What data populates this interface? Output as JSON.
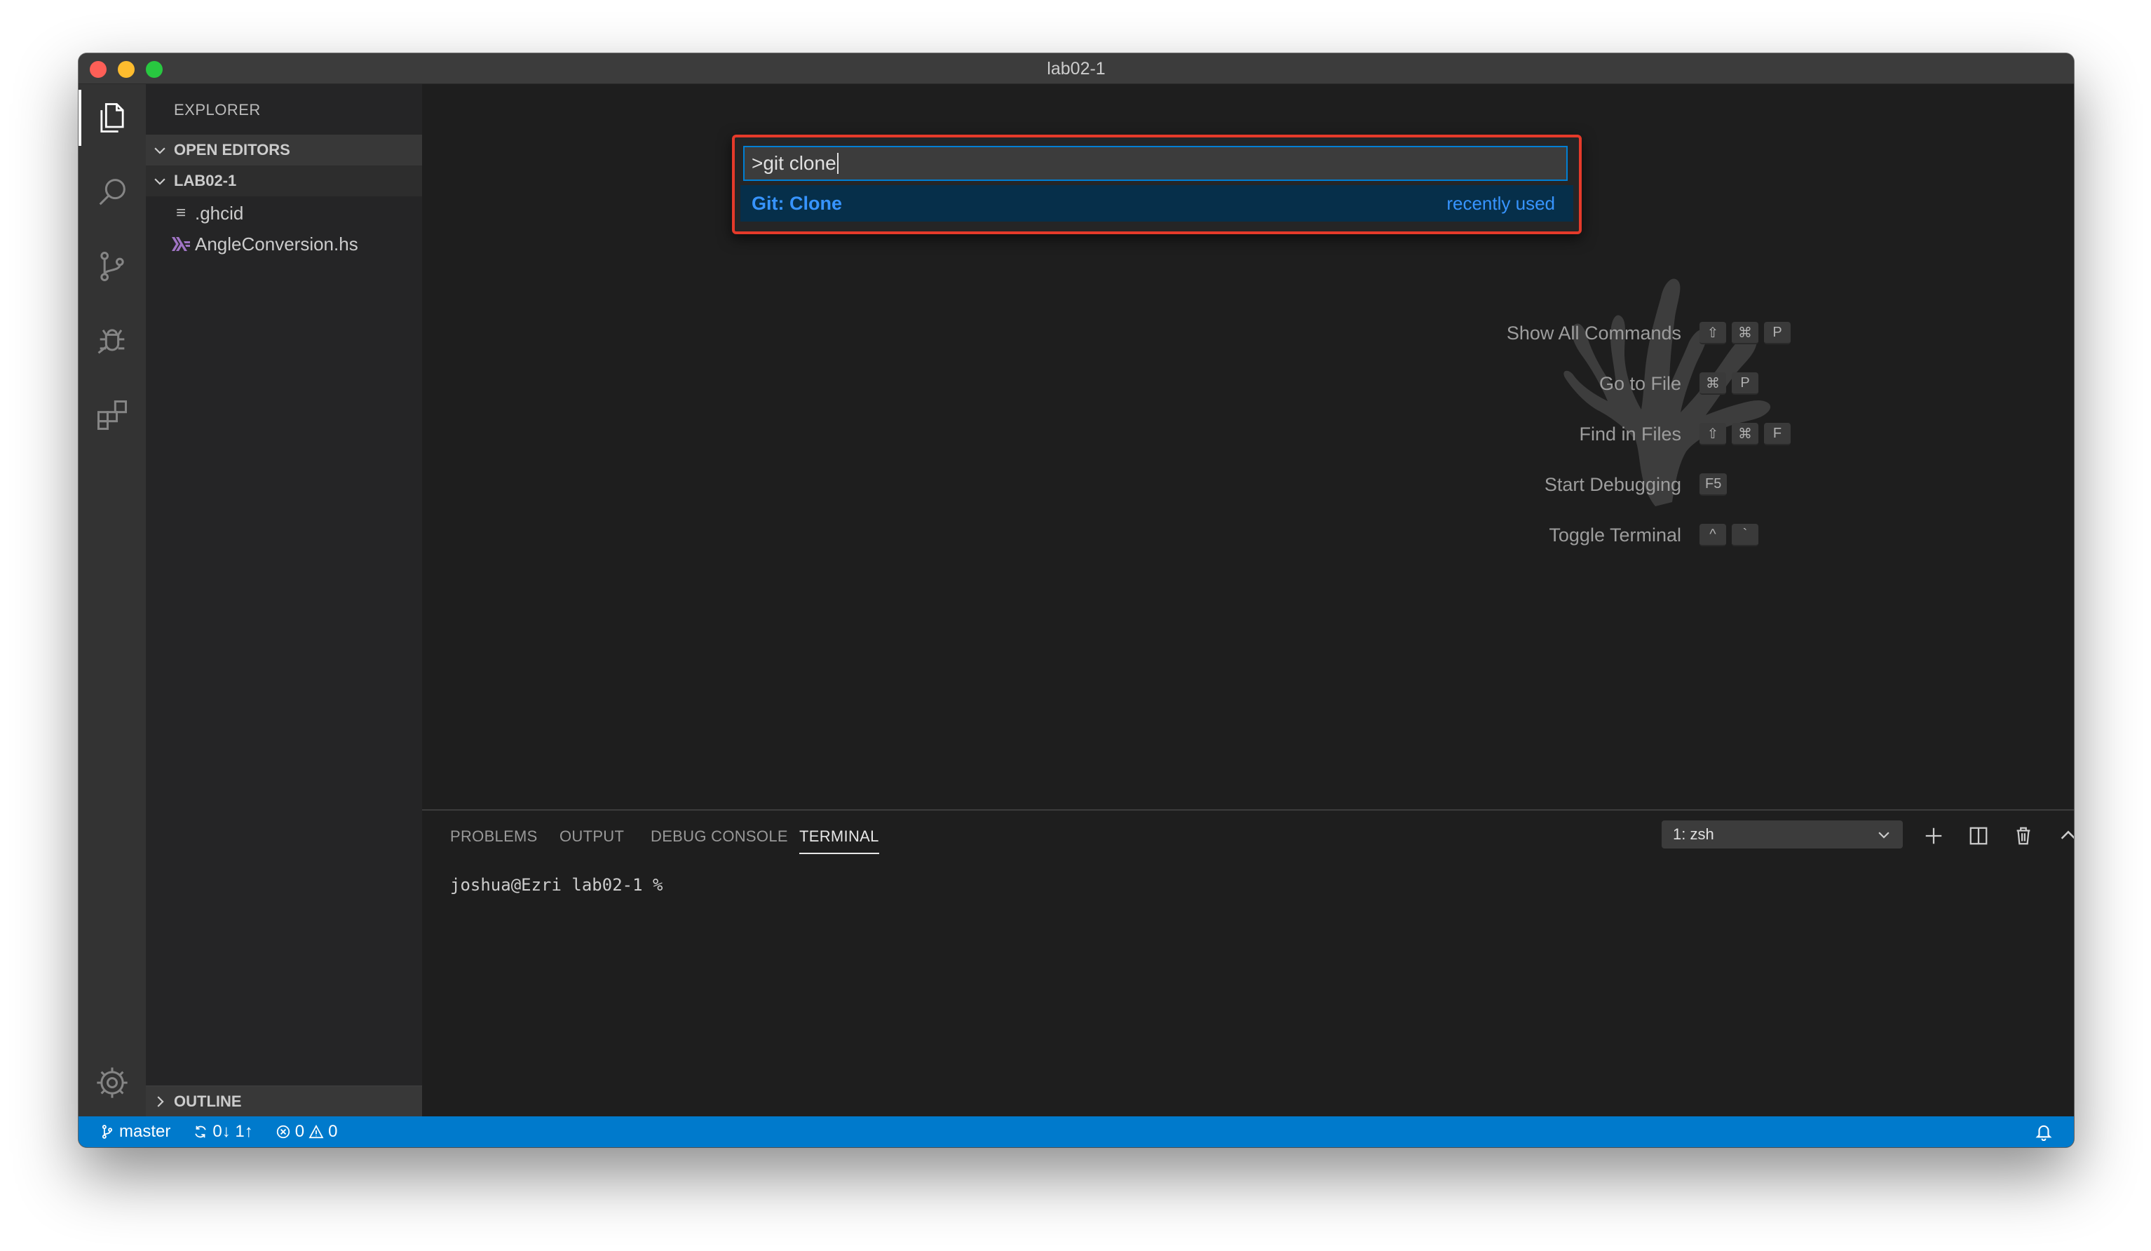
{
  "window": {
    "title": "lab02-1"
  },
  "colors": {
    "statusbar": "#007acc",
    "palette_border": "#e53a2a",
    "accent_blue": "#3794ff"
  },
  "activity_bar": {
    "items": [
      {
        "icon": "files-icon",
        "active": true
      },
      {
        "icon": "search-icon"
      },
      {
        "icon": "source-control-icon"
      },
      {
        "icon": "debug-icon"
      },
      {
        "icon": "extensions-icon"
      }
    ],
    "bottom_icon": "gear-icon"
  },
  "sidebar": {
    "title": "EXPLORER",
    "sections": {
      "open_editors": "OPEN EDITORS",
      "folder": "LAB02-1",
      "outline": "OUTLINE"
    },
    "files": [
      {
        "name": ".ghcid",
        "icon": "file-lines-icon"
      },
      {
        "name": "AngleConversion.hs",
        "icon": "haskell-icon"
      }
    ]
  },
  "command_palette": {
    "input_value": ">git clone",
    "result_label": "Git: Clone",
    "result_hint": "recently used"
  },
  "shortcuts": [
    {
      "label": "Show All Commands",
      "keys": [
        "⇧",
        "⌘",
        "P"
      ]
    },
    {
      "label": "Go to File",
      "keys": [
        "⌘",
        "P"
      ]
    },
    {
      "label": "Find in Files",
      "keys": [
        "⇧",
        "⌘",
        "F"
      ]
    },
    {
      "label": "Start Debugging",
      "keys": [
        "F5"
      ]
    },
    {
      "label": "Toggle Terminal",
      "keys": [
        "^",
        "`"
      ]
    }
  ],
  "panel": {
    "tabs": [
      "PROBLEMS",
      "OUTPUT",
      "DEBUG CONSOLE",
      "TERMINAL"
    ],
    "active_tab": "TERMINAL",
    "terminal_select": "1: zsh",
    "terminal_prompt": "joshua@Ezri lab02-1 %"
  },
  "statusbar": {
    "branch": "master",
    "sync": "0↓ 1↑",
    "errors": "0",
    "warnings": "0"
  }
}
